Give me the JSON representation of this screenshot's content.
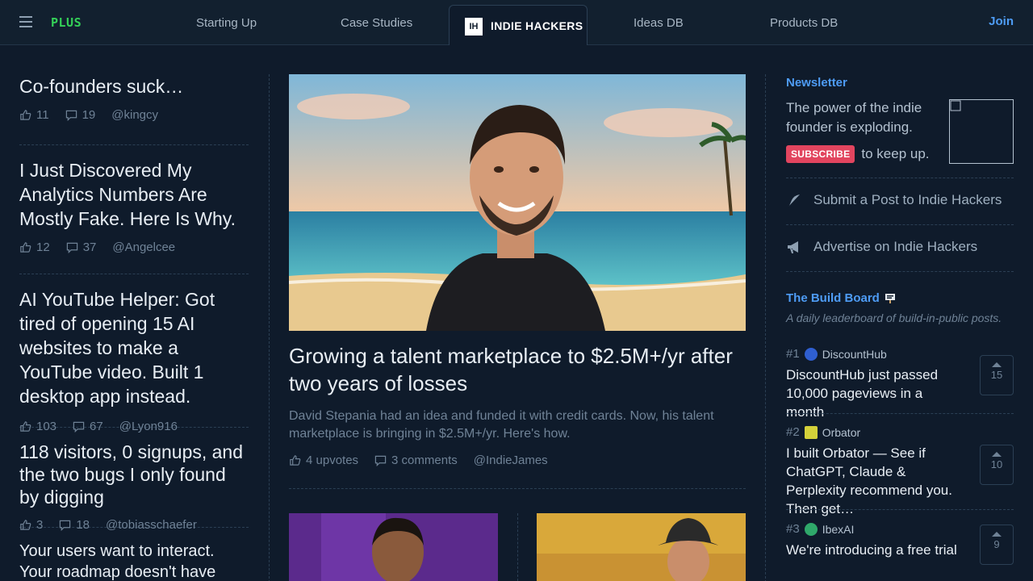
{
  "nav": {
    "plus": "PLUS",
    "links": [
      "Starting Up",
      "Case Studies",
      "Ideas DB",
      "Products DB"
    ],
    "brand_mark": "IH",
    "brand": "INDIE HACKERS",
    "join": "Join"
  },
  "left_posts": [
    {
      "title": "Co-founders suck…",
      "upvotes": "11",
      "comments": "19",
      "author": "@kingcy"
    },
    {
      "title": "I Just Discovered My Analytics Numbers Are Mostly Fake. Here Is Why.",
      "upvotes": "12",
      "comments": "37",
      "author": "@Angelcee"
    },
    {
      "title": "AI YouTube Helper: Got tired of opening 15 AI websites to make a YouTube video. Built 1 desktop app instead.",
      "upvotes": "103",
      "comments": "67",
      "author": "@Lyon916"
    },
    {
      "title": "118 visitors, 0 signups, and the two bugs I only found by digging",
      "upvotes": "3",
      "comments": "18",
      "author": "@tobiasschaefer"
    },
    {
      "title": "Your users want to interact. Your roadmap doesn't have weeks to",
      "upvotes": "",
      "comments": "",
      "author": ""
    }
  ],
  "feature": {
    "title": "Growing a talent marketplace to $2.5M+/yr after two years of losses",
    "description": "David Stepania had an idea and funded it with credit cards. Now, his talent marketplace is bringing in $2.5M+/yr. Here's how.",
    "upvotes": "4 upvotes",
    "comments": "3 comments",
    "author": "@IndieJames"
  },
  "newsletter": {
    "label": "Newsletter",
    "text": "The power of the indie founder is exploding.",
    "subscribe": "SUBSCRIBE",
    "tail": "to keep up."
  },
  "links": {
    "submit": "Submit a Post to Indie Hackers",
    "advertise": "Advertise on Indie Hackers"
  },
  "build_board": {
    "title": "The Build Board",
    "subtitle": "A daily leaderboard of build-in-public posts.",
    "items": [
      {
        "rank": "#1",
        "product": "DiscountHub",
        "title": "DiscountHub just passed 10,000 pageviews in a month",
        "votes": "15"
      },
      {
        "rank": "#2",
        "product": "Orbator",
        "title": "I built Orbator — See if ChatGPT, Claude & Perplexity recommend you. Then get…",
        "votes": "10"
      },
      {
        "rank": "#3",
        "product": "IbexAI",
        "title": "We're introducing a free trial",
        "votes": "9"
      }
    ]
  },
  "colors": {
    "background": "#0f1b2b",
    "accent": "#4e9cf5",
    "plus_green": "#34d058",
    "subscribe": "#e2455f"
  }
}
